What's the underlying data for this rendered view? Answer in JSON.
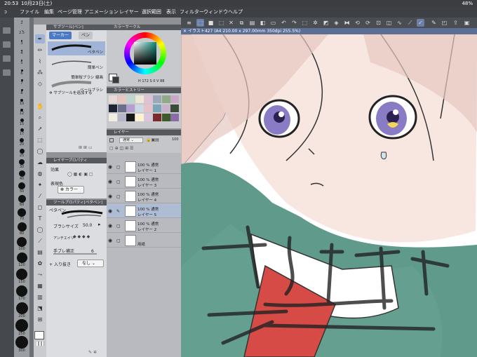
{
  "status": {
    "time": "20:53",
    "date": "10月23日(土)",
    "battery": "48%"
  },
  "menu": [
    "ファイル",
    "編集",
    "ページ管理",
    "アニメーション",
    "レイヤー",
    "選択範囲",
    "表示",
    "フィルター",
    "ウィンドウ",
    "ヘルプ"
  ],
  "brush_sizes": [
    "2",
    "2.5",
    "3",
    "4",
    "5",
    "6",
    "7",
    "8",
    "10",
    "12",
    "15",
    "17",
    "20",
    "25",
    "30",
    "40",
    "50",
    "60",
    "70",
    "80",
    "100",
    "120",
    "150",
    "170",
    "200",
    "250",
    "300"
  ],
  "subtool": {
    "title": "サブツール[ペン]",
    "tabs": [
      "マーカー",
      "ペン"
    ],
    "brushes": [
      "ペタペン",
      "簡単ペン",
      "簡単桜ブラシ 線画",
      "ベールブラシ"
    ],
    "add": "サブツールを追加する"
  },
  "layer_property": {
    "title": "レイヤープロパティ",
    "effect": "効果",
    "color_label": "表現色",
    "color_value": "カラー"
  },
  "tool_property": {
    "title": "ツールプロパティ[ペタペン]",
    "brush_name": "ペタペン",
    "size_label": "ブラシサイズ",
    "size_value": "50.0",
    "aa_label": "アンチエイリ",
    "stab_label": "手ブレ補正",
    "stab_value": "6",
    "in_out_label": "入り抜き",
    "in_out_value": "なし"
  },
  "color_circle": {
    "title": "カラーサークル",
    "h": "172",
    "s": "0",
    "v": "88"
  },
  "history": {
    "title": "カラーヒストリー",
    "swatches": [
      "#e9d9d5",
      "#e7c7c2",
      "#c1d6cf",
      "#efe7d6",
      "#dfc0d6",
      "#9ba8b8",
      "#8eaa86",
      "#c8a7c7",
      "#1e2433",
      "#6b6f8a",
      "#b3a0cf",
      "#cbd8e6",
      "#e8c0c7",
      "#7ba5b8",
      "#c9b2c8",
      "#3a4c3a",
      "#f0eee0",
      "#b5b7c9",
      "#181818",
      "#fff2cf",
      "#d9c5de",
      "#7a2a2a",
      "#3d5c2a",
      "#8a6da8"
    ]
  },
  "layers": {
    "title": "レイヤー",
    "blend": "通常",
    "opacity": "100",
    "rows": [
      {
        "percent": "100 %  通常",
        "name": "レイヤー 1",
        "selected": false
      },
      {
        "percent": "100 %  通常",
        "name": "レイヤー 3",
        "selected": false
      },
      {
        "percent": "100 %  通常",
        "name": "レイヤー 4",
        "selected": false
      },
      {
        "percent": "100 %  通常",
        "name": "レイヤー 5",
        "selected": true
      },
      {
        "percent": "100 %  通常",
        "name": "レイヤー 2",
        "selected": false
      },
      {
        "percent": "",
        "name": "用紙",
        "selected": false
      }
    ]
  },
  "canvas": {
    "tab": "イラスト427 (A4 210.00 x 297.00mm 350dpi 255.5%)"
  }
}
